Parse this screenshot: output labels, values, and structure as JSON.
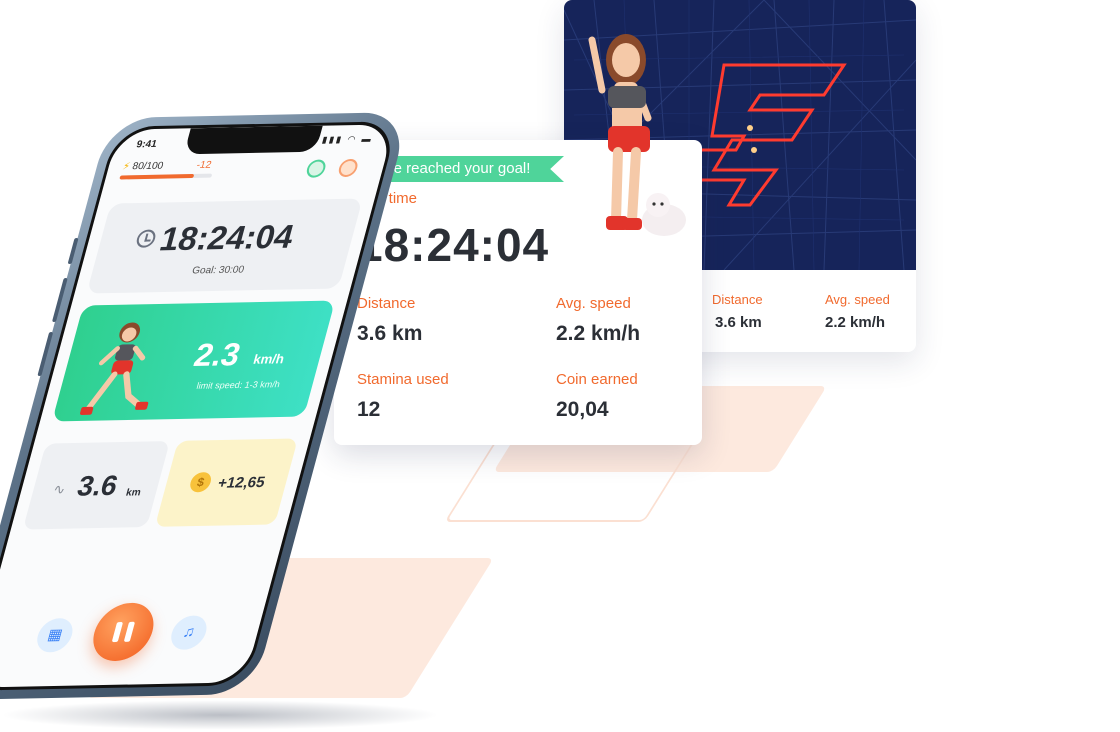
{
  "phone": {
    "status_time": "9:41",
    "status_icons": "▮▮▮ ◠ ▬",
    "stamina": "80/100",
    "stamina_delta": "-12",
    "stamina_level": 0.8,
    "timer": "18:24:04",
    "goal": "Goal: 30:00",
    "speed": "2.3",
    "speed_unit": "km/h",
    "speed_limit": "limit speed: 1-3 km/h",
    "distance": "3.6",
    "distance_unit": "km",
    "coins": "+12,65",
    "coin_symbol": "$"
  },
  "result": {
    "banner": "You've reached your goal!",
    "run_time_label": "Run time",
    "run_time": "18:24:04",
    "distance_label": "Distance",
    "distance": "3.6 km",
    "avg_speed_label": "Avg. speed",
    "avg_speed": "2.2 km/h",
    "stamina_label": "Stamina used",
    "stamina": "12",
    "coin_label": "Coin earned",
    "coin": "20,04"
  },
  "map_card": {
    "distance_label": "Distance",
    "distance": "3.6 km",
    "avg_speed_label": "Avg. speed",
    "avg_speed": "2.2 km/h"
  },
  "colors": {
    "accent": "#f16a2e",
    "goal_green": "#4fd49a",
    "map_bg": "#16245a",
    "route_red": "#ff3b2f"
  },
  "icons": [
    "clock-icon",
    "route-icon",
    "coin-icon",
    "pause-icon",
    "map-icon",
    "music-icon",
    "bolt-icon"
  ]
}
